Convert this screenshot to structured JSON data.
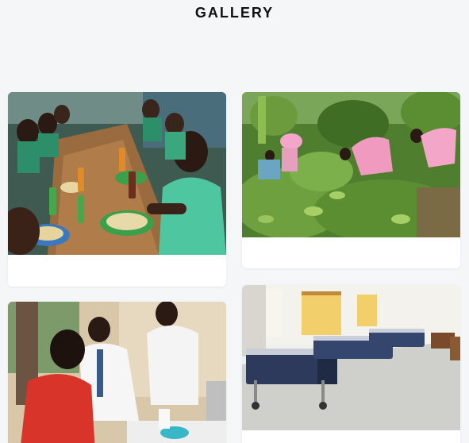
{
  "gallery": {
    "title": "GALLERY",
    "items": [
      {
        "image": "children-eating-meal-photo"
      },
      {
        "image": "children-working-in-garden-photo"
      },
      {
        "image": "medical-examination-photo"
      },
      {
        "image": "hospital-ward-beds-photo"
      }
    ]
  },
  "colors": {
    "background": "#f5f6f8",
    "card": "#ffffff",
    "title": "#111111"
  }
}
